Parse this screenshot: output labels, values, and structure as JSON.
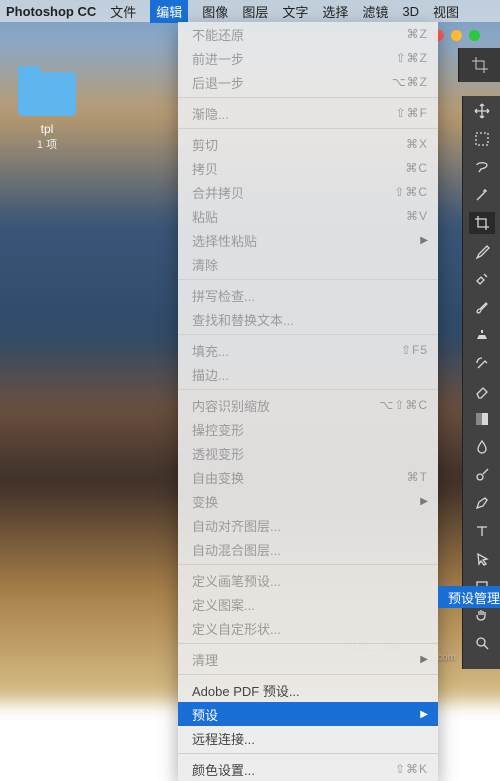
{
  "menubar": {
    "app": "Photoshop CC",
    "items": [
      "文件",
      "编辑",
      "图像",
      "图层",
      "文字",
      "选择",
      "滤镜",
      "3D",
      "视图"
    ],
    "active_index": 1
  },
  "desktop": {
    "folder": {
      "name": "tpl",
      "subtitle": "1 项"
    }
  },
  "dropdown": {
    "groups": [
      [
        {
          "label": "不能还原",
          "shortcut": "⌘Z",
          "disabled": true
        },
        {
          "label": "前进一步",
          "shortcut": "⇧⌘Z",
          "disabled": true
        },
        {
          "label": "后退一步",
          "shortcut": "⌥⌘Z",
          "disabled": true
        }
      ],
      [
        {
          "label": "渐隐...",
          "shortcut": "⇧⌘F",
          "disabled": true
        }
      ],
      [
        {
          "label": "剪切",
          "shortcut": "⌘X",
          "disabled": true
        },
        {
          "label": "拷贝",
          "shortcut": "⌘C",
          "disabled": true
        },
        {
          "label": "合并拷贝",
          "shortcut": "⇧⌘C",
          "disabled": true
        },
        {
          "label": "粘贴",
          "shortcut": "⌘V",
          "disabled": true
        },
        {
          "label": "选择性粘贴",
          "submenu": true,
          "disabled": true
        },
        {
          "label": "清除",
          "disabled": true
        }
      ],
      [
        {
          "label": "拼写检查...",
          "disabled": true
        },
        {
          "label": "查找和替换文本...",
          "disabled": true
        }
      ],
      [
        {
          "label": "填充...",
          "shortcut": "⇧F5",
          "disabled": true
        },
        {
          "label": "描边...",
          "disabled": true
        }
      ],
      [
        {
          "label": "内容识别缩放",
          "shortcut": "⌥⇧⌘C",
          "disabled": true
        },
        {
          "label": "操控变形",
          "disabled": true
        },
        {
          "label": "透视变形",
          "disabled": true
        },
        {
          "label": "自由变换",
          "shortcut": "⌘T",
          "disabled": true
        },
        {
          "label": "变换",
          "submenu": true,
          "disabled": true
        },
        {
          "label": "自动对齐图层...",
          "disabled": true
        },
        {
          "label": "自动混合图层...",
          "disabled": true
        }
      ],
      [
        {
          "label": "定义画笔预设...",
          "disabled": true
        },
        {
          "label": "定义图案...",
          "disabled": true
        },
        {
          "label": "定义自定形状...",
          "disabled": true
        }
      ],
      [
        {
          "label": "清理",
          "submenu": true,
          "disabled": true
        }
      ],
      [
        {
          "label": "Adobe PDF 预设..."
        },
        {
          "label": "预设",
          "submenu": true,
          "highlight": true
        },
        {
          "label": "远程连接..."
        }
      ],
      [
        {
          "label": "颜色设置...",
          "shortcut": "⇧⌘K"
        }
      ]
    ]
  },
  "submenu": {
    "label": "预设管理器..."
  },
  "watermark": {
    "main": "jb51.net",
    "sub": "jiaocheng.chazidian.com"
  }
}
